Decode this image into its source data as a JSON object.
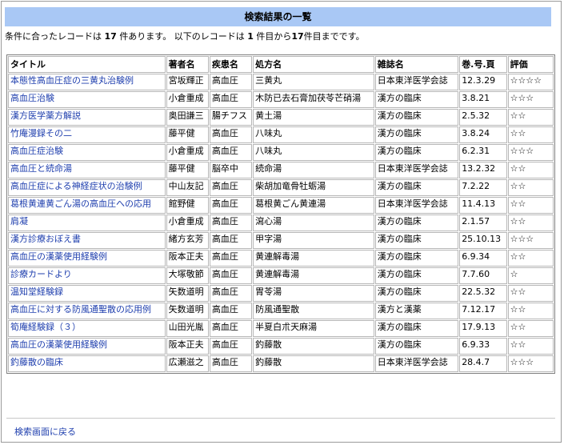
{
  "header": {
    "title": "検索結果の一覧"
  },
  "summary": {
    "part1": "条件に合ったレコードは",
    "count": "17",
    "part2": "件あります。 以下のレコードは",
    "from": "1",
    "part3": "件目から",
    "to": "17",
    "part4": "件目までです。"
  },
  "table": {
    "headers": [
      "タイトル",
      "著者名",
      "疾患名",
      "処方名",
      "雑誌名",
      "巻.号.頁",
      "評価"
    ],
    "rows": [
      [
        "本態性高血圧症の三黄丸治験例",
        "宮坂輝正",
        "高血圧",
        "三黄丸",
        "日本東洋医学会誌",
        "12.3.29",
        "☆☆☆☆"
      ],
      [
        "高血圧治験",
        "小倉重成",
        "高血圧",
        "木防已去石膏加茯苓芒硝湯",
        "漢方の臨床",
        "3.8.21",
        "☆☆☆"
      ],
      [
        "漢方医学薬方解説",
        "奥田謙三",
        "腸チフス",
        "黄土湯",
        "漢方の臨床",
        "2.5.32",
        "☆☆"
      ],
      [
        "竹庵漫録その二",
        "藤平健",
        "高血圧",
        "八味丸",
        "漢方の臨床",
        "3.8.24",
        "☆☆"
      ],
      [
        "高血圧症治験",
        "小倉重成",
        "高血圧",
        "八味丸",
        "漢方の臨床",
        "6.2.31",
        "☆☆☆"
      ],
      [
        "高血圧と続命湯",
        "藤平健",
        "脳卒中",
        "続命湯",
        "日本東洋医学会誌",
        "13.2.32",
        "☆☆"
      ],
      [
        "高血圧症による神経症状の治験例",
        "中山友記",
        "高血圧",
        "柴胡加竜骨牡蛎湯",
        "漢方の臨床",
        "7.2.22",
        "☆☆"
      ],
      [
        "葛根黄連黄ごん湯の高血圧への応用",
        "館野健",
        "高血圧",
        "葛根黄ごん黄連湯",
        "日本東洋医学会誌",
        "11.4.13",
        "☆☆"
      ],
      [
        "肩凝",
        "小倉重成",
        "高血圧",
        "瀉心湯",
        "漢方の臨床",
        "2.1.57",
        "☆☆"
      ],
      [
        "漢方診療おぼえ書",
        "緒方玄芳",
        "高血圧",
        "甲字湯",
        "漢方の臨床",
        "25.10.13",
        "☆☆☆"
      ],
      [
        "高血圧の漢薬使用経験例",
        "阪本正夫",
        "高血圧",
        "黄連解毒湯",
        "漢方の臨床",
        "6.9.34",
        "☆☆"
      ],
      [
        "診療カードより",
        "大塚敬節",
        "高血圧",
        "黄連解毒湯",
        "漢方の臨床",
        "7.7.60",
        "☆"
      ],
      [
        "温知堂経験録",
        "矢数道明",
        "高血圧",
        "胃苓湯",
        "漢方の臨床",
        "22.5.32",
        "☆☆"
      ],
      [
        "高血圧に対する防風通聖散の応用例",
        "矢数道明",
        "高血圧",
        "防風通聖散",
        "漢方と漢薬",
        "7.12.17",
        "☆☆"
      ],
      [
        "筍庵経験録（３）",
        "山田光胤",
        "高血圧",
        "半夏白朮天麻湯",
        "漢方の臨床",
        "17.9.13",
        "☆☆"
      ],
      [
        "高血圧の漢薬使用経験例",
        "阪本正夫",
        "高血圧",
        "釣藤散",
        "漢方の臨床",
        "6.9.33",
        "☆☆"
      ],
      [
        "釣藤散の臨床",
        "広瀬滋之",
        "高血圧",
        "釣藤散",
        "日本東洋医学会誌",
        "28.4.7",
        "☆☆☆"
      ]
    ]
  },
  "footer": {
    "back_link": "検索画面に戻る"
  }
}
